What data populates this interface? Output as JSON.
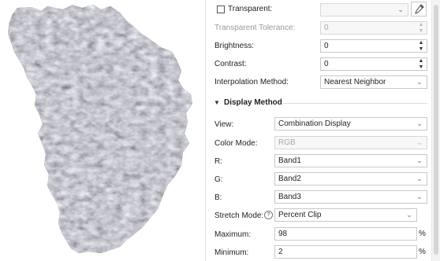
{
  "colors": {
    "panel_bg": "#ffffff",
    "border": "#c8c8c8",
    "disabled_text": "#9a9a9a",
    "terrain_dark": "#3a3b44",
    "terrain_light": "#b9b7bd"
  },
  "preview": {
    "image_name": "terrain-raster-preview"
  },
  "transparent": {
    "label": "Transparent:",
    "checked": false,
    "color_value": "",
    "pick_icon": "eyedropper-icon"
  },
  "transparent_tolerance": {
    "label": "Transparent Tolerance:",
    "value": "0"
  },
  "brightness": {
    "label": "Brightness:",
    "value": "0"
  },
  "contrast": {
    "label": "Contrast:",
    "value": "0"
  },
  "interpolation": {
    "label": "Interpolation Method:",
    "value": "Nearest Neighbor"
  },
  "display_method": {
    "title": "Display Method",
    "view": {
      "label": "View:",
      "value": "Combination Display"
    },
    "color_mode": {
      "label": "Color Mode:",
      "value": "RGB"
    },
    "r": {
      "label": "R:",
      "value": "Band1"
    },
    "g": {
      "label": "G:",
      "value": "Band2"
    },
    "b": {
      "label": "B:",
      "value": "Band3"
    },
    "stretch_mode": {
      "label": "Stretch Mode:",
      "value": "Percent Clip",
      "help_icon": "help-circle-icon"
    },
    "maximum": {
      "label": "Maximum:",
      "value": "98",
      "unit": "%"
    },
    "minimum": {
      "label": "Minimum:",
      "value": "2",
      "unit": "%"
    }
  }
}
